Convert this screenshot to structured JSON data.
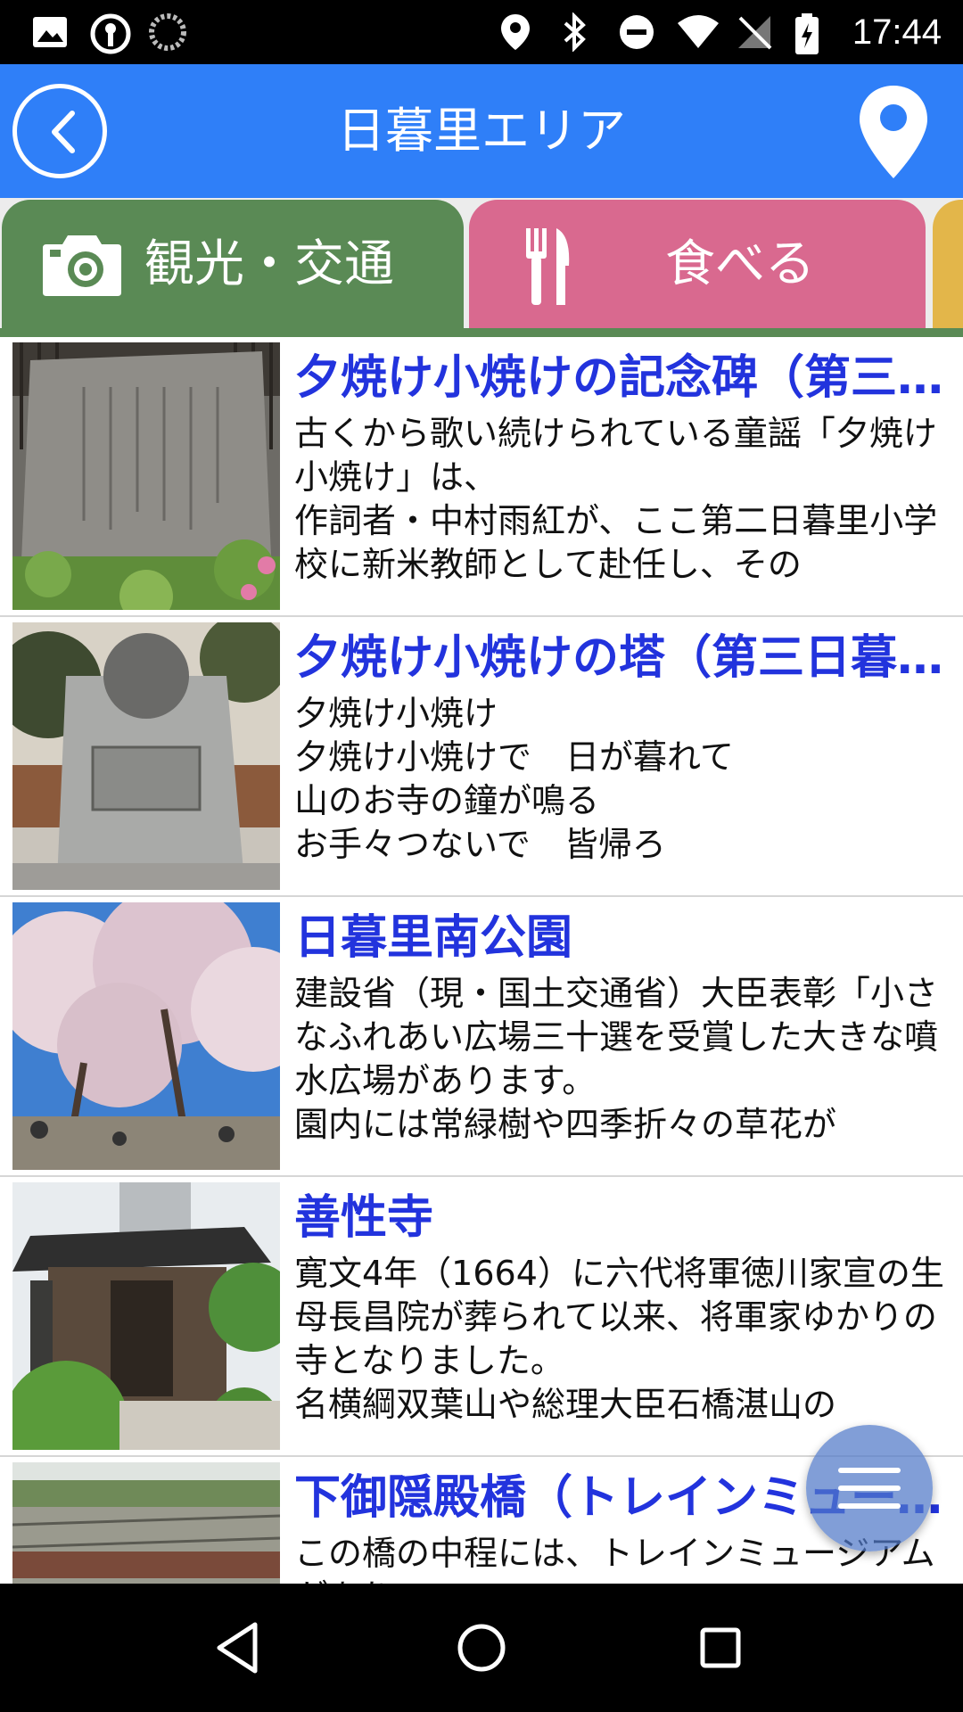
{
  "status_bar": {
    "time": "17:44",
    "left_icons": [
      "image-icon",
      "location-key-icon",
      "sync-spinner-icon"
    ],
    "right_icons": [
      "location-icon",
      "bluetooth-icon",
      "do-not-disturb-icon",
      "wifi-icon",
      "no-sim-icon",
      "battery-charging-icon"
    ]
  },
  "header": {
    "title": "日暮里エリア",
    "background": "#2f7ff8"
  },
  "tabs": [
    {
      "label": "観光・交通",
      "icon": "camera-icon",
      "color": "#5a8a55",
      "selected": true
    },
    {
      "label": "食べる",
      "icon": "fork-knife-icon",
      "color": "#d9698f",
      "selected": false
    },
    {
      "label": "",
      "icon": "",
      "color": "#e3b64a",
      "selected": false
    }
  ],
  "items": [
    {
      "title": "夕焼け小焼けの記念碑（第三日暮里小学校）",
      "desc": "古くから歌い続けられている童謡「夕焼け小焼け」は、\n作詞者・中村雨紅が、ここ第二日暮里小学校に新米教師として赴任し、その",
      "thumb": "stone-monument-photo"
    },
    {
      "title": "夕焼け小焼けの塔（第三日暮里小学校）",
      "desc": "夕焼け小焼け\n夕焼け小焼けで　日が暮れて\n山のお寺の鐘が鳴る\nお手々つないで　皆帰ろ",
      "thumb": "monument-tower-photo"
    },
    {
      "title": "日暮里南公園",
      "desc": "建設省（現・国土交通省）大臣表彰「小さなふれあい広場三十選を受賞した大きな噴水広場があります。\n園内には常緑樹や四季折々の草花が",
      "thumb": "cherry-blossom-park-photo"
    },
    {
      "title": "善性寺",
      "desc": "寛文4年（1664）に六代将軍徳川家宣の生母長昌院が葬られて以来、将軍家ゆかりの寺となりました。\n名横綱双葉山や総理大臣石橋湛山の",
      "thumb": "temple-gate-photo"
    },
    {
      "title": "下御隠殿橋（トレインミュージアム）",
      "desc": "この橋の中程には、トレインミュージアムがあり",
      "thumb": "railway-tracks-photo"
    }
  ],
  "fab": {
    "icon": "menu-icon"
  },
  "nav_bar": {
    "buttons": [
      "back-nav-icon",
      "home-nav-icon",
      "recents-nav-icon"
    ]
  }
}
